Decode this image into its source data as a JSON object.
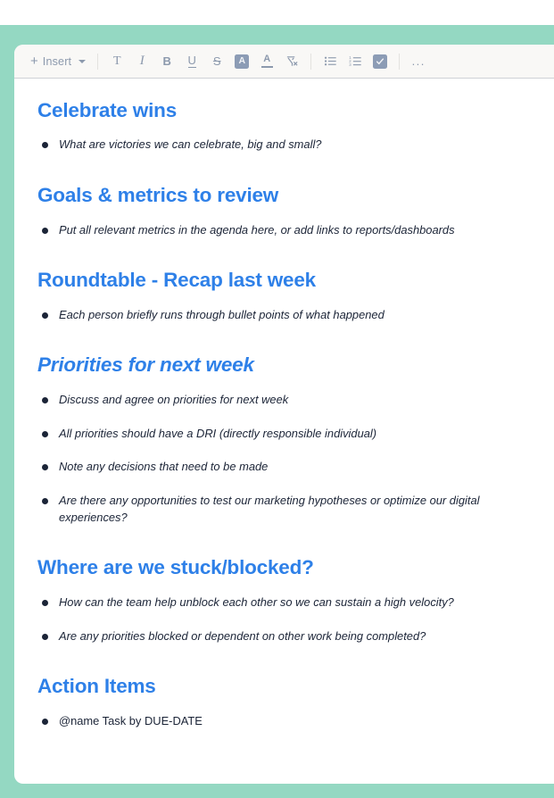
{
  "theme": {
    "background_mint": "#94d8c2",
    "card_background": "#ffffff",
    "toolbar_background": "#f9f8f6",
    "heading_color": "#2e80e8",
    "body_text_color": "#1b2437",
    "toolbar_icon_color": "#8c99ad",
    "icon_active_fill": "#8c9cb5"
  },
  "toolbar": {
    "insert_label": "Insert",
    "insert_plus": "+",
    "buttons": [
      {
        "name": "text-style",
        "glyph": "T",
        "label": "Text style"
      },
      {
        "name": "italic",
        "glyph": "I",
        "label": "Italic"
      },
      {
        "name": "bold",
        "glyph": "B",
        "label": "Bold"
      },
      {
        "name": "underline",
        "glyph": "U",
        "label": "Underline"
      },
      {
        "name": "strikethrough",
        "glyph": "S",
        "label": "Strikethrough"
      },
      {
        "name": "highlight",
        "glyph": "A",
        "label": "Highlight color"
      },
      {
        "name": "font-color",
        "glyph": "A",
        "label": "Font color"
      },
      {
        "name": "clear-formatting",
        "glyph": "T",
        "label": "Clear formatting"
      },
      {
        "name": "bulleted-list",
        "glyph": "",
        "label": "Bulleted list"
      },
      {
        "name": "numbered-list",
        "glyph": "",
        "label": "Numbered list"
      },
      {
        "name": "checklist",
        "glyph": "",
        "label": "Checklist"
      },
      {
        "name": "more-options",
        "glyph": "...",
        "label": "More options"
      }
    ]
  },
  "document": {
    "sections": [
      {
        "title": "Celebrate wins",
        "title_italic": false,
        "items": [
          {
            "text": "What are victories we can celebrate, big and small?",
            "italic": true
          }
        ]
      },
      {
        "title": "Goals & metrics to review",
        "title_italic": false,
        "items": [
          {
            "text": "Put all relevant metrics in the agenda here, or add links to reports/dashboards",
            "italic": true
          }
        ]
      },
      {
        "title": "Roundtable - Recap last week",
        "title_italic": false,
        "items": [
          {
            "text": "Each person briefly runs through bullet points of what happened",
            "italic": true
          }
        ]
      },
      {
        "title": "Priorities for next week",
        "title_italic": true,
        "items": [
          {
            "text": "Discuss and agree on priorities for next week",
            "italic": true
          },
          {
            "text": "All priorities should have a DRI (directly responsible individual)",
            "italic": true
          },
          {
            "text": "Note any decisions that need to be made",
            "italic": true
          },
          {
            "text": "Are there any opportunities to test our marketing hypotheses or optimize our digital experiences?",
            "italic": true
          }
        ]
      },
      {
        "title": "Where are we stuck/blocked?",
        "title_italic": false,
        "items": [
          {
            "text": "How can the team help unblock each other so we can sustain a high velocity?",
            "italic": true
          },
          {
            "text": "Are any priorities blocked or dependent on other work being completed?",
            "italic": true
          }
        ]
      },
      {
        "title": "Action Items",
        "title_italic": false,
        "items": [
          {
            "text": "@name Task by DUE-DATE",
            "italic": false
          }
        ]
      }
    ]
  }
}
